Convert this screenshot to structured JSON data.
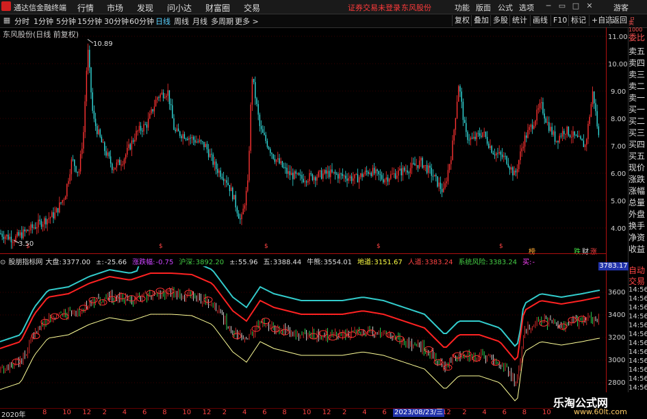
{
  "menubar": {
    "app_name": "通达信金融终端",
    "items": [
      "行情",
      "市场",
      "发现",
      "问小达",
      "财富圈",
      "交易"
    ],
    "warning": "证券交易未登录",
    "stock": "东风股份",
    "right_items": [
      "功能",
      "版面",
      "公式",
      "选项"
    ],
    "guest": "游客"
  },
  "toolbar": {
    "periods": [
      "分时",
      "1分钟",
      "5分钟",
      "15分钟",
      "30分钟",
      "60分钟",
      "日线",
      "周线",
      "月线",
      "多周期",
      "更多 >"
    ],
    "active_period": "日线",
    "right_items": [
      "复权",
      "叠加",
      "多股",
      "统计",
      "画线",
      "F10",
      "标记",
      "+自选",
      "返回"
    ]
  },
  "main_chart": {
    "title": "东风股份(日线 前复权)",
    "high_label": "10.89",
    "low_label": "3.50",
    "y_ticks": [
      "11.00",
      "10.00",
      "9.00",
      "8.00",
      "7.00",
      "6.00",
      "5.00",
      "4.00"
    ],
    "marker_labels": [
      "$",
      "$",
      "$",
      "$",
      "$",
      "$",
      "$",
      "$"
    ],
    "right_markers": [
      "榜",
      "跌",
      "财",
      "涨"
    ]
  },
  "sidebar": {
    "top_label": "委比",
    "items": [
      "卖五",
      "卖四",
      "卖三",
      "卖二",
      "卖一",
      "买一",
      "买二",
      "买三",
      "买四",
      "买五",
      "现价",
      "涨跌",
      "涨幅",
      "总量",
      "外盘",
      "换手",
      "净资",
      "收益"
    ],
    "auto_label": "自动",
    "trade_label": "交易"
  },
  "indicator": {
    "name": "股朋指标网",
    "fields": [
      {
        "label": "大盘:",
        "value": "3377.00",
        "color": "#e0e0e0"
      },
      {
        "label": "±:",
        "value": "-25.66",
        "color": "#e0e0e0"
      },
      {
        "label": "涨跌幅:",
        "value": "-0.75",
        "color": "#cc44ff"
      },
      {
        "label": "沪深:",
        "value": "3892.20",
        "color": "#44cc44"
      },
      {
        "label": "±:",
        "value": "55.96",
        "color": "#e0e0e0"
      },
      {
        "label": "五:",
        "value": "3388.44",
        "color": "#e0e0e0"
      },
      {
        "label": "牛熊:",
        "value": "3554.01",
        "color": "#e0e0e0"
      },
      {
        "label": "地道:",
        "value": "3151.67",
        "color": "#ffff44"
      },
      {
        "label": "人道:",
        "value": "3383.24",
        "color": "#ff4444"
      },
      {
        "label": "系统风险:",
        "value": "3383.24",
        "color": "#44cc44"
      },
      {
        "label": "买:",
        "value": "-",
        "color": "#ff44ff"
      }
    ],
    "current_value": "3783.17",
    "y_ticks": [
      "3600",
      "3400",
      "3200",
      "3000",
      "2800"
    ],
    "right_times": [
      "14:56",
      "14:56",
      "14:56",
      "14:56",
      "14:56",
      "14:56",
      "14:56",
      "14:56",
      "14:56",
      "14:56",
      "14:56",
      "14:56",
      "14:56"
    ]
  },
  "xaxis": {
    "start_label": "2020年",
    "ticks": [
      "8",
      "10",
      "12",
      "2",
      "4",
      "6",
      "8",
      "10",
      "12",
      "2",
      "4",
      "6",
      "8",
      "10",
      "12",
      "2",
      "4",
      "6",
      "8",
      "10",
      "12",
      "2",
      "4",
      "6",
      "8",
      "10",
      "12",
      "2"
    ],
    "cursor_date": "2023/08/23/三"
  },
  "watermark": {
    "line1": "乐淘公式网",
    "line2": "www.60lt.com"
  },
  "colors": {
    "bull": "#ff3333",
    "bear": "#33dddd",
    "ma_yellow": "#ffff99",
    "upper": "#ff2222",
    "upper2": "#33cccc",
    "axis_red": "#b01010"
  }
}
